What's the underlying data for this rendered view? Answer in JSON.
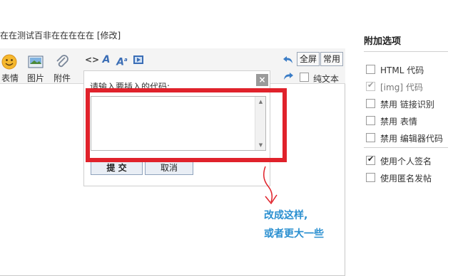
{
  "subject": {
    "text": "在在测试百非在在在在在 [修改]"
  },
  "toolbar": {
    "emoji_label": "表情",
    "image_label": "图片",
    "attach_label": "附件",
    "fullscreen_label": "全屏",
    "common_label": "常用",
    "plaintext_label": "纯文本"
  },
  "dialog": {
    "label": "请输入要插入的代码:",
    "submit_label": "提 交",
    "cancel_label": "取消",
    "close_glyph": "×"
  },
  "annotation": {
    "line1": "改成这样,",
    "line2": "或者更大一些",
    "box_color": "#e0222b",
    "text_color": "#2a8fd0"
  },
  "options": {
    "title": "附加选项",
    "items": [
      {
        "label": "HTML 代码",
        "checked": false,
        "dim": false
      },
      {
        "label": "[img] 代码",
        "checked": true,
        "dim": true
      },
      {
        "label": "禁用 链接识别",
        "checked": false,
        "dim": false
      },
      {
        "label": "禁用 表情",
        "checked": false,
        "dim": false
      },
      {
        "label": "禁用 编辑器代码",
        "checked": false,
        "dim": false
      },
      {
        "label": "使用个人签名",
        "checked": true,
        "dim": false
      },
      {
        "label": "使用匿名发帖",
        "checked": false,
        "dim": false
      }
    ]
  }
}
